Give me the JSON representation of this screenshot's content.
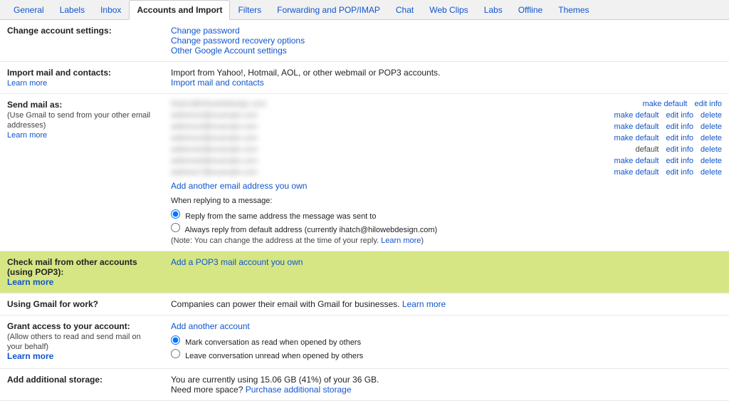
{
  "nav": {
    "tabs": [
      {
        "label": "General",
        "id": "general",
        "active": false
      },
      {
        "label": "Labels",
        "id": "labels",
        "active": false
      },
      {
        "label": "Inbox",
        "id": "inbox",
        "active": false
      },
      {
        "label": "Accounts and Import",
        "id": "accounts",
        "active": true
      },
      {
        "label": "Filters",
        "id": "filters",
        "active": false
      },
      {
        "label": "Forwarding and POP/IMAP",
        "id": "forwarding",
        "active": false
      },
      {
        "label": "Chat",
        "id": "chat",
        "active": false
      },
      {
        "label": "Web Clips",
        "id": "webclips",
        "active": false
      },
      {
        "label": "Labs",
        "id": "labs",
        "active": false
      },
      {
        "label": "Offline",
        "id": "offline",
        "active": false
      },
      {
        "label": "Themes",
        "id": "themes",
        "active": false
      }
    ]
  },
  "sections": {
    "change_account": {
      "label": "Change account settings:",
      "links": [
        {
          "text": "Change password",
          "href": "#"
        },
        {
          "text": "Change password recovery options",
          "href": "#"
        },
        {
          "text": "Other Google Account settings",
          "href": "#"
        }
      ]
    },
    "import": {
      "label": "Import mail and contacts:",
      "learn_more": "Learn more",
      "description": "Import from Yahoo!, Hotmail, AOL, or other webmail or POP3 accounts.",
      "action": "Import mail and contacts"
    },
    "send_mail": {
      "label": "Send mail as:",
      "sublabel": "(Use Gmail to send from your other email addresses)",
      "learn_more": "Learn more",
      "emails": [
        {
          "addr": "████████@████████.███",
          "actions": [
            "make default",
            "edit info"
          ],
          "is_default": false
        },
        {
          "addr": "████████@████████.███",
          "actions": [
            "make default",
            "edit info",
            "delete"
          ],
          "is_default": false
        },
        {
          "addr": "████████@████████.███",
          "actions": [
            "make default",
            "edit info",
            "delete"
          ],
          "is_default": false
        },
        {
          "addr": "████████@████████.███",
          "actions": [
            "make default",
            "edit info",
            "delete"
          ],
          "is_default": false
        },
        {
          "addr": "████████@████████.███",
          "actions": [
            "default",
            "edit info",
            "delete"
          ],
          "is_default": true
        },
        {
          "addr": "████████@████████.███",
          "actions": [
            "make default",
            "edit info",
            "delete"
          ],
          "is_default": false
        },
        {
          "addr": "████████@████████.███",
          "actions": [
            "make default",
            "edit info",
            "delete"
          ],
          "is_default": false
        }
      ],
      "add_email": "Add another email address you own",
      "reply_section": {
        "title": "When replying to a message:",
        "option1": "Reply from the same address the message was sent to",
        "option2": "Always reply from default address (currently ihatch@hilowebdesign.com)",
        "note": "(Note: You can change the address at the time of your reply. Learn more)"
      }
    },
    "check_mail": {
      "label": "Check mail from other accounts (using POP3):",
      "learn_more": "Learn more",
      "action": "Add a POP3 mail account you own",
      "highlighted": true
    },
    "gmail_work": {
      "label": "Using Gmail for work?",
      "description": "Companies can power their email with Gmail for businesses.",
      "learn_more": "Learn more"
    },
    "grant_access": {
      "label": "Grant access to your account:",
      "sublabel": "(Allow others to read and send mail on your behalf)",
      "learn_more": "Learn more",
      "add_account": "Add another account",
      "options": [
        {
          "label": "Mark conversation as read when opened by others",
          "selected": true
        },
        {
          "label": "Leave conversation unread when opened by others",
          "selected": false
        }
      ]
    },
    "storage": {
      "label": "Add additional storage:",
      "description": "You are currently using 15.06 GB (41%) of your 36 GB.",
      "description2": "Need more space?",
      "purchase": "Purchase additional storage"
    }
  }
}
